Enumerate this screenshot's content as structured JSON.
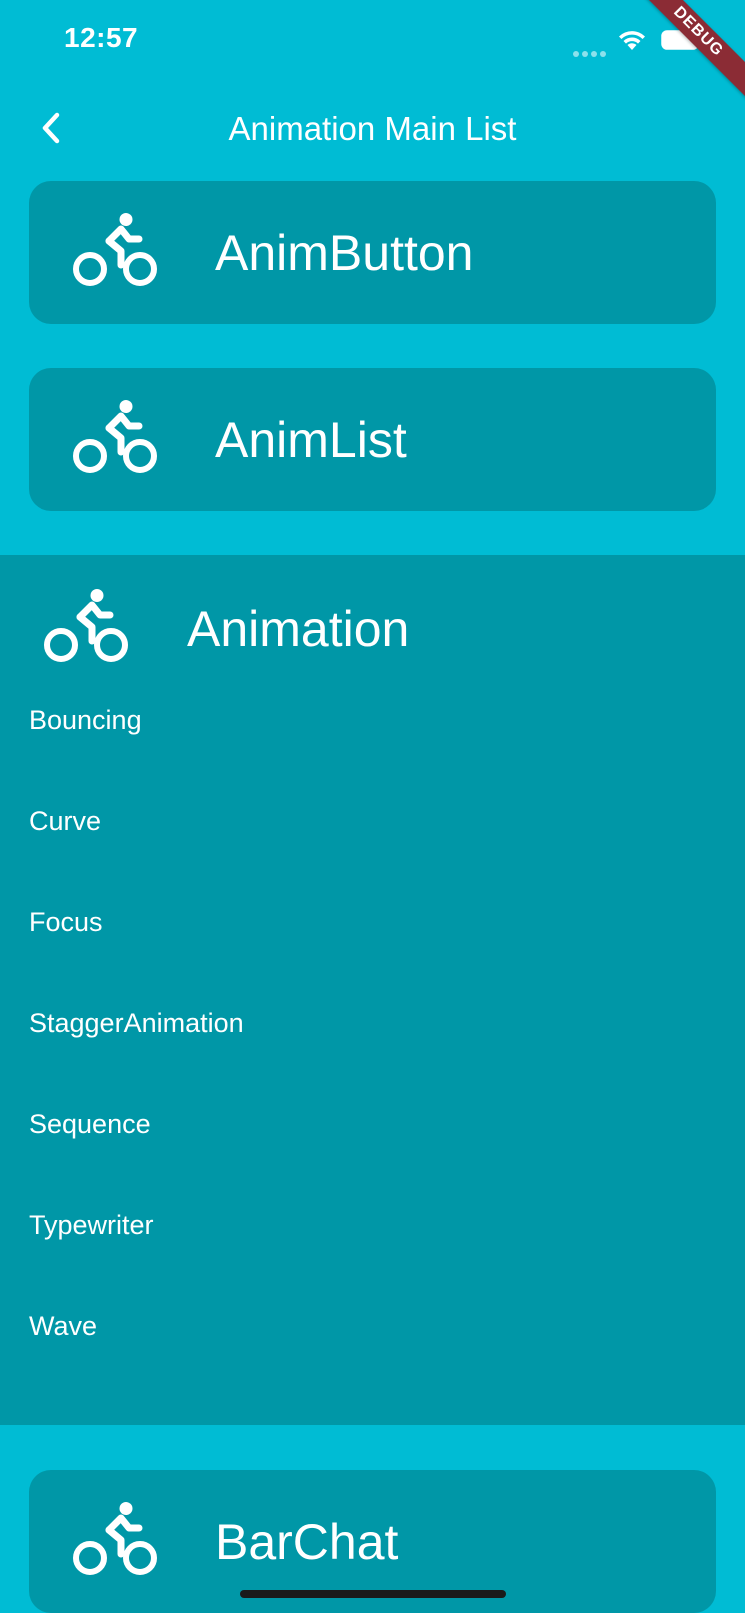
{
  "status_bar": {
    "time": "12:57",
    "debug_label": "DEBUG"
  },
  "app_bar": {
    "title": "Animation Main List",
    "back_icon": "chevron-left-icon"
  },
  "items": [
    {
      "label": "AnimButton",
      "icon": "bike-icon"
    },
    {
      "label": "AnimList",
      "icon": "bike-icon"
    }
  ],
  "expanded": {
    "label": "Animation",
    "icon": "bike-icon",
    "children": [
      "Bouncing",
      "Curve",
      "Focus",
      "StaggerAnimation",
      "Sequence",
      "Typewriter",
      "Wave"
    ]
  },
  "bottom_item": {
    "label": "BarChat",
    "icon": "bike-icon"
  },
  "colors": {
    "background": "#00BCD4",
    "card": "#0097A7",
    "text": "#FFFFFF",
    "debug_ribbon": "#8B2C35"
  }
}
